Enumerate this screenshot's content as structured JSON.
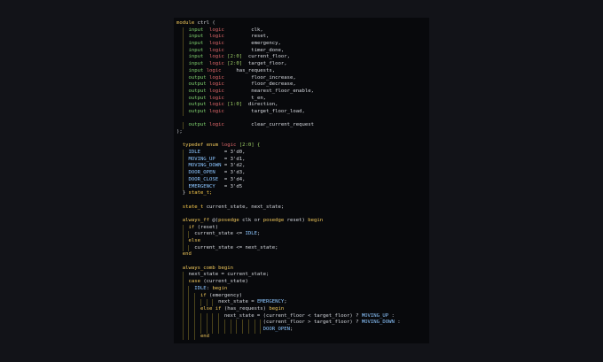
{
  "colors": {
    "background": "#121318",
    "editor": "#08090c",
    "keyword": "#f0c75a",
    "type": "#e0686a",
    "direction": "#7fcf6e",
    "state": "#8bc5ff"
  },
  "code": [
    [
      {
        "t": "module ",
        "c": "kw"
      },
      {
        "t": "ctrl (",
        "c": "id"
      }
    ],
    [
      {
        "t": "    input ",
        "c": "io"
      },
      {
        "t": " logic",
        "c": "type"
      },
      {
        "t": "         clk,",
        "c": "id"
      }
    ],
    [
      {
        "t": "    input ",
        "c": "io"
      },
      {
        "t": " logic",
        "c": "type"
      },
      {
        "t": "         reset,",
        "c": "id"
      }
    ],
    [
      {
        "t": "    input ",
        "c": "io"
      },
      {
        "t": " logic",
        "c": "type"
      },
      {
        "t": "         emergency,",
        "c": "id"
      }
    ],
    [
      {
        "t": "    input ",
        "c": "io"
      },
      {
        "t": " logic",
        "c": "type"
      },
      {
        "t": "         timer_done,",
        "c": "id"
      }
    ],
    [
      {
        "t": "    input ",
        "c": "io"
      },
      {
        "t": " logic",
        "c": "type"
      },
      {
        "t": " [2:0]",
        "c": "green"
      },
      {
        "t": "  current_floor,",
        "c": "id"
      }
    ],
    [
      {
        "t": "    input ",
        "c": "io"
      },
      {
        "t": " logic",
        "c": "type"
      },
      {
        "t": " [2:0]",
        "c": "green"
      },
      {
        "t": "  target_floor,",
        "c": "id"
      }
    ],
    [
      {
        "t": "    input ",
        "c": "io"
      },
      {
        "t": "logic",
        "c": "type"
      },
      {
        "t": "     has_requests,",
        "c": "id"
      }
    ],
    [
      {
        "t": "    output",
        "c": "io"
      },
      {
        "t": " logic",
        "c": "type"
      },
      {
        "t": "         floor_increase,",
        "c": "id"
      }
    ],
    [
      {
        "t": "    output",
        "c": "io"
      },
      {
        "t": " logic",
        "c": "type"
      },
      {
        "t": "         floor_decrease,",
        "c": "id"
      }
    ],
    [
      {
        "t": "    output",
        "c": "io"
      },
      {
        "t": " logic",
        "c": "type"
      },
      {
        "t": "         nearest_floor_enable,",
        "c": "id"
      }
    ],
    [
      {
        "t": "    output",
        "c": "io"
      },
      {
        "t": " logic",
        "c": "type"
      },
      {
        "t": "         t_en,",
        "c": "id"
      }
    ],
    [
      {
        "t": "    output",
        "c": "io"
      },
      {
        "t": " logic",
        "c": "type"
      },
      {
        "t": " [1:0]",
        "c": "green"
      },
      {
        "t": "  direction,",
        "c": "id"
      }
    ],
    [
      {
        "t": "    output",
        "c": "io"
      },
      {
        "t": " logic",
        "c": "type"
      },
      {
        "t": "         target_floor_load,",
        "c": "id"
      }
    ],
    [
      {
        "t": "",
        "c": "id"
      }
    ],
    [
      {
        "t": "    output",
        "c": "io"
      },
      {
        "t": " logic",
        "c": "type"
      },
      {
        "t": "         clear_current_request",
        "c": "id"
      }
    ],
    [
      {
        "t": ");",
        "c": "id"
      }
    ],
    [
      {
        "t": "",
        "c": "id"
      }
    ],
    [
      {
        "t": "  typedef ",
        "c": "kw"
      },
      {
        "t": "enum ",
        "c": "kw"
      },
      {
        "t": "logic ",
        "c": "type"
      },
      {
        "t": "[2:0] {",
        "c": "green"
      }
    ],
    [
      {
        "t": "    IDLE",
        "c": "blue"
      },
      {
        "t": "        = 3'd0,",
        "c": "id"
      }
    ],
    [
      {
        "t": "    MOVING_UP",
        "c": "blue"
      },
      {
        "t": "   = 3'd1,",
        "c": "id"
      }
    ],
    [
      {
        "t": "    MOVING_DOWN",
        "c": "blue"
      },
      {
        "t": " = 3'd2,",
        "c": "id"
      }
    ],
    [
      {
        "t": "    DOOR_OPEN",
        "c": "blue"
      },
      {
        "t": "   = 3'd3,",
        "c": "id"
      }
    ],
    [
      {
        "t": "    DOOR_CLOSE",
        "c": "blue"
      },
      {
        "t": "  = 3'd4,",
        "c": "id"
      }
    ],
    [
      {
        "t": "    EMERGENCY",
        "c": "blue"
      },
      {
        "t": "   = 3'd5",
        "c": "id"
      }
    ],
    [
      {
        "t": "  } ",
        "c": "id"
      },
      {
        "t": "state_t;",
        "c": "const"
      }
    ],
    [
      {
        "t": "",
        "c": "id"
      }
    ],
    [
      {
        "t": "  state_t ",
        "c": "const"
      },
      {
        "t": "current_state, next_state;",
        "c": "id"
      }
    ],
    [
      {
        "t": "",
        "c": "id"
      }
    ],
    [
      {
        "t": "  always_ff ",
        "c": "kw"
      },
      {
        "t": "@(",
        "c": "id"
      },
      {
        "t": "posedge ",
        "c": "kw"
      },
      {
        "t": "clk or ",
        "c": "id"
      },
      {
        "t": "posedge ",
        "c": "kw"
      },
      {
        "t": "reset) ",
        "c": "id"
      },
      {
        "t": "begin",
        "c": "kw"
      }
    ],
    [
      {
        "t": "    if ",
        "c": "kw"
      },
      {
        "t": "(reset)",
        "c": "id"
      }
    ],
    [
      {
        "t": "      current_state <= ",
        "c": "id"
      },
      {
        "t": "IDLE",
        "c": "blue"
      },
      {
        "t": ";",
        "c": "id"
      }
    ],
    [
      {
        "t": "    else",
        "c": "kw"
      }
    ],
    [
      {
        "t": "      current_state <= next_state;",
        "c": "id"
      }
    ],
    [
      {
        "t": "  end",
        "c": "kw"
      }
    ],
    [
      {
        "t": "",
        "c": "id"
      }
    ],
    [
      {
        "t": "  always_comb ",
        "c": "kw"
      },
      {
        "t": "begin",
        "c": "kw"
      }
    ],
    [
      {
        "t": "    next_state = current_state;",
        "c": "id"
      }
    ],
    [
      {
        "t": "    case ",
        "c": "kw"
      },
      {
        "t": "(current_state)",
        "c": "id"
      }
    ],
    [
      {
        "t": "      IDLE",
        "c": "blue"
      },
      {
        "t": ": ",
        "c": "id"
      },
      {
        "t": "begin",
        "c": "kw"
      }
    ],
    [
      {
        "t": "        if ",
        "c": "kw"
      },
      {
        "t": "(emergency)",
        "c": "id"
      }
    ],
    [
      {
        "t": "              next_state = ",
        "c": "id"
      },
      {
        "t": "EMERGENCY",
        "c": "blue"
      },
      {
        "t": ";",
        "c": "id"
      }
    ],
    [
      {
        "t": "        else if ",
        "c": "kw"
      },
      {
        "t": "(has_requests) ",
        "c": "id"
      },
      {
        "t": "begin",
        "c": "kw"
      }
    ],
    [
      {
        "t": "                next_state = (current_floor < target_floor) ? ",
        "c": "id"
      },
      {
        "t": "MOVING_UP",
        "c": "blue"
      },
      {
        "t": " :",
        "c": "id"
      }
    ],
    [
      {
        "t": "                             (current_floor > target_floor) ? ",
        "c": "id"
      },
      {
        "t": "MOVING_DOWN",
        "c": "blue"
      },
      {
        "t": " :",
        "c": "id"
      }
    ],
    [
      {
        "t": "                             ",
        "c": "id"
      },
      {
        "t": "DOOR_OPEN",
        "c": "blue"
      },
      {
        "t": ";",
        "c": "id"
      }
    ],
    [
      {
        "t": "        end",
        "c": "kw"
      }
    ]
  ]
}
